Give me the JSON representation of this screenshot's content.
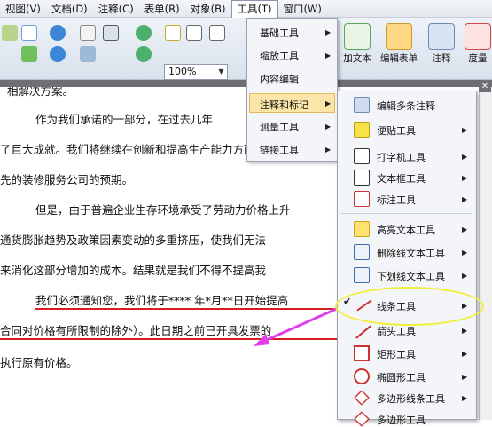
{
  "menubar": [
    "视图(V)",
    "文档(D)",
    "注释(C)",
    "表单(R)",
    "对象(B)",
    "工具(T)",
    "窗口(W)"
  ],
  "toolbar": {
    "zoom_value": "100%",
    "buttons": [
      "加文本",
      "编辑表单",
      "注释",
      "度量"
    ]
  },
  "tools_menu": [
    {
      "label": "基础工具"
    },
    {
      "label": "缩放工具"
    },
    {
      "label": "内容编辑"
    },
    {
      "label": "注释和标记"
    },
    {
      "label": "测量工具"
    },
    {
      "label": "链接工具"
    }
  ],
  "annot_menu": [
    "编辑多条注释",
    "便贴工具",
    "打字机工具",
    "文本框工具",
    "标注工具",
    "高亮文本工具",
    "删除线文本工具",
    "下划线文本工具",
    "线条工具",
    "箭头工具",
    "矩形工具",
    "椭圆形工具",
    "多边形线条工具",
    "多边形工具"
  ],
  "doc_lines": [
    "相解决方案。",
    "作为我们承诺的一部分，在过去几年",
    "了巨大成就。我们将继续在创新和提高生产能力方面加",
    "先的装修服务公司的预期。",
    "但是，由于普遍企业生存环境承受了劳动力价格上升",
    "通货膨胀趋势及政策因素变动的多重挤压，使我们无法",
    "来消化这部分增加的成本。结果就是我们不得不提高我",
    "我们必须通知您，我们将于**** 年*月**日开始提高",
    "合同对价格有所限制的除外）。此日期之前已开具发票的",
    "执行原有价格。"
  ],
  "colors": {
    "accent_yellow": "#f2ef3a",
    "arrow_magenta": "#e23ee8",
    "underline_red": "#d81e22"
  }
}
